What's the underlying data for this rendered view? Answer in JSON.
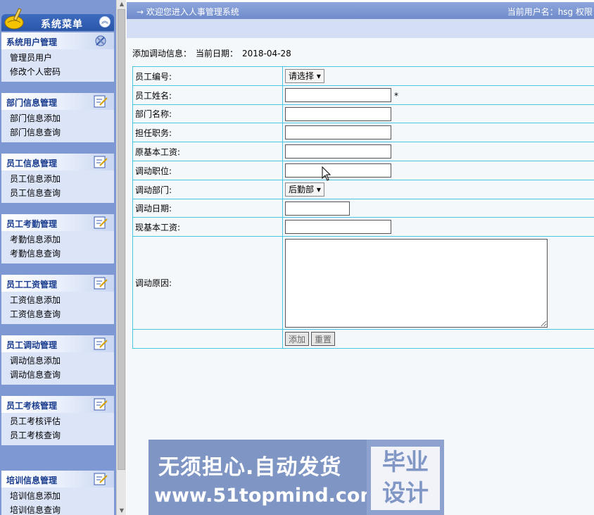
{
  "menu": {
    "title": "系统菜单",
    "groups": [
      {
        "title": "系统用户管理",
        "icon": "tools-icon",
        "items": [
          "管理员用户",
          "修改个人密码"
        ]
      },
      {
        "title": "部门信息管理",
        "icon": "edit-note-icon",
        "items": [
          "部门信息添加",
          "部门信息查询"
        ]
      },
      {
        "title": "员工信息管理",
        "icon": "edit-note-icon",
        "items": [
          "员工信息添加",
          "员工信息查询"
        ]
      },
      {
        "title": "员工考勤管理",
        "icon": "edit-note-icon",
        "items": [
          "考勤信息添加",
          "考勤信息查询"
        ]
      },
      {
        "title": "员工工资管理",
        "icon": "edit-note-icon",
        "items": [
          "工资信息添加",
          "工资信息查询"
        ]
      },
      {
        "title": "员工调动管理",
        "icon": "edit-note-icon",
        "items": [
          "调动信息添加",
          "调动信息查询"
        ]
      },
      {
        "title": "员工考核管理",
        "icon": "edit-note-icon",
        "items": [
          "员工考核评估",
          "员工考核查询"
        ]
      },
      {
        "title": "培训信息管理",
        "icon": "edit-note-icon",
        "items": [
          "培训信息添加",
          "培训信息查询"
        ]
      }
    ]
  },
  "topbar": {
    "welcome": "→ 欢迎您进入人事管理系统",
    "user_info": "当前用户名：hsg 权限"
  },
  "form": {
    "heading": "添加调动信息：",
    "date_label": "当前日期：",
    "date": "2018-04-28",
    "fields": {
      "employee_id": {
        "label": "员工编号:",
        "value": "请选择 ▾"
      },
      "employee_name": {
        "label": "员工姓名:",
        "value": "",
        "required_mark": "*"
      },
      "department_name": {
        "label": "部门名称:",
        "value": ""
      },
      "position": {
        "label": "担任职务:",
        "value": ""
      },
      "original_salary": {
        "label": "原基本工资:",
        "value": ""
      },
      "new_position": {
        "label": "调动职位:",
        "value": ""
      },
      "new_department": {
        "label": "调动部门:",
        "value": "后勤部 ▾"
      },
      "transfer_date": {
        "label": "调动日期:",
        "value": ""
      },
      "current_salary": {
        "label": "现基本工资:",
        "value": ""
      },
      "reason": {
        "label": "调动原因:",
        "value": ""
      }
    },
    "add_button": "添加",
    "reset_button": "重置"
  },
  "watermark": {
    "slogan": "无须担心.自动发货",
    "url": "www.51topmind.com",
    "badge_line1": "毕业",
    "badge_line2": "设计"
  },
  "colors": {
    "menu_bg": "#7e98d4",
    "menu_header": "#2a56a8",
    "group_title": "#1a3c8f",
    "table_border": "#49c5e0",
    "topbar": "#7f97d2"
  }
}
